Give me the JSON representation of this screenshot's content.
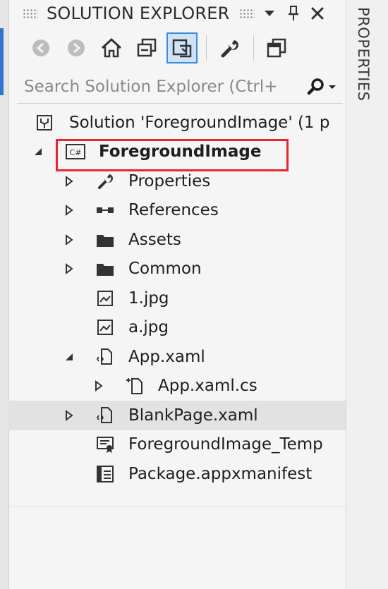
{
  "panel": {
    "title": "SOLUTION EXPLORER",
    "pin_icon": "pin-icon",
    "dropdown_icon": "dropdown-arrow-icon",
    "close_icon": "close-icon"
  },
  "toolbar": {
    "buttons": [
      {
        "name": "back-button",
        "icon": "back-arrow-icon"
      },
      {
        "name": "forward-button",
        "icon": "forward-arrow-icon"
      },
      {
        "name": "home-button",
        "icon": "home-icon"
      },
      {
        "name": "collapse-all-button",
        "icon": "collapse-icon"
      },
      {
        "name": "sync-active-document-button",
        "icon": "sync-icon",
        "active": true
      },
      {
        "name": "properties-button",
        "icon": "wrench-icon"
      },
      {
        "name": "new-view-button",
        "icon": "windows-icon"
      }
    ]
  },
  "search": {
    "placeholder": "Search Solution Explorer (Ctrl+"
  },
  "side_tab": {
    "label": "PROPERTIES"
  },
  "tree": [
    {
      "label": "Solution 'ForegroundImage' (1 p",
      "icon": "solution-icon",
      "expander": "none"
    },
    {
      "label": "ForegroundImage",
      "icon": "csharp-project-icon",
      "expander": "expanded",
      "bold": true,
      "highlighted": true
    },
    {
      "label": "Properties",
      "icon": "wrench-icon",
      "expander": "collapsed"
    },
    {
      "label": "References",
      "icon": "references-icon",
      "expander": "collapsed"
    },
    {
      "label": "Assets",
      "icon": "folder-icon",
      "expander": "collapsed"
    },
    {
      "label": "Common",
      "icon": "folder-icon",
      "expander": "collapsed"
    },
    {
      "label": "1.jpg",
      "icon": "image-file-icon",
      "expander": "none"
    },
    {
      "label": "a.jpg",
      "icon": "image-file-icon",
      "expander": "none"
    },
    {
      "label": "App.xaml",
      "icon": "xaml-file-icon",
      "expander": "expanded"
    },
    {
      "label": "App.xaml.cs",
      "icon": "cs-code-file-icon",
      "expander": "collapsed"
    },
    {
      "label": "BlankPage.xaml",
      "icon": "xaml-file-icon",
      "expander": "collapsed",
      "hover": true
    },
    {
      "label": "ForegroundImage_Temp",
      "icon": "certificate-icon",
      "expander": "none"
    },
    {
      "label": "Package.appxmanifest",
      "icon": "manifest-icon",
      "expander": "none"
    }
  ],
  "colors": {
    "accent": "#3a8ddb",
    "highlight_border": "#e8262d",
    "hover_row": "#e2e2e2"
  }
}
